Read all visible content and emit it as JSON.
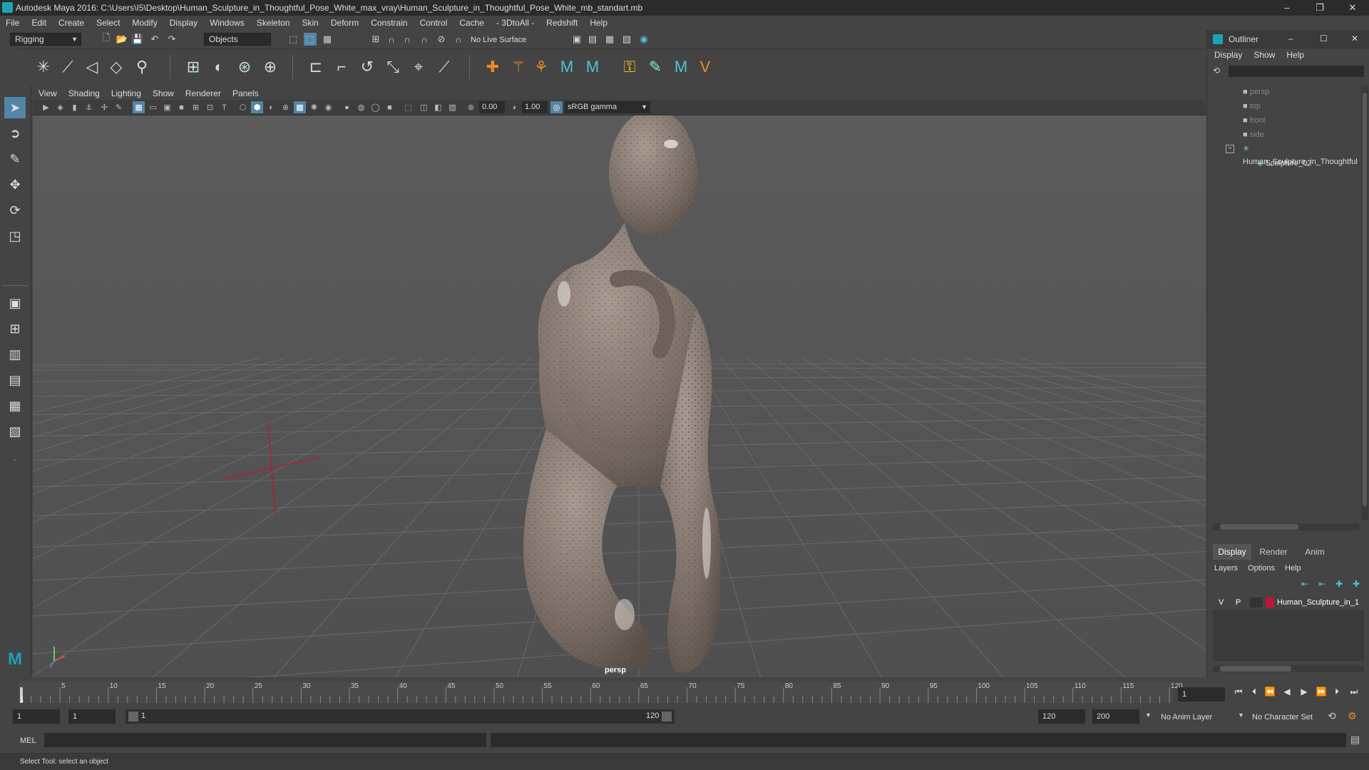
{
  "window": {
    "title": "Autodesk Maya 2016: C:\\Users\\I5\\Desktop\\Human_Sculpture_in_Thoughtful_Pose_White_max_vray\\Human_Sculpture_in_Thoughtful_Pose_White_mb_standart.mb",
    "minimize": "–",
    "restore": "❐",
    "close": "✕"
  },
  "menubar": [
    "File",
    "Edit",
    "Create",
    "Select",
    "Modify",
    "Display",
    "Windows",
    "Skeleton",
    "Skin",
    "Deform",
    "Constrain",
    "Control",
    "Cache",
    "- 3DtoAll -",
    "Redshift",
    "Help"
  ],
  "statusline": {
    "menuset": "Rigging",
    "selection_mode": "Objects",
    "live_surface": "No Live Surface"
  },
  "panel": {
    "menus": [
      "View",
      "Shading",
      "Lighting",
      "Show",
      "Renderer",
      "Panels"
    ],
    "exposure": "0.00",
    "gamma": "1.00",
    "colorspace": "sRGB gamma",
    "camera_label": "persp"
  },
  "outliner": {
    "title": "Outliner",
    "minimize": "–",
    "maximize": "☐",
    "close": "✕",
    "menus": [
      "Display",
      "Show",
      "Help"
    ],
    "items": [
      {
        "label": "persp",
        "type": "camera"
      },
      {
        "label": "top",
        "type": "camera"
      },
      {
        "label": "front",
        "type": "camera"
      },
      {
        "label": "side",
        "type": "camera"
      },
      {
        "label": "Human_Sculpture_in_Thoughtful",
        "type": "group"
      },
      {
        "label": "Sculpture_02",
        "type": "mesh"
      }
    ]
  },
  "layer_editor": {
    "tabs": [
      "Display",
      "Render",
      "Anim"
    ],
    "active_tab": "Display",
    "menus": [
      "Layers",
      "Options",
      "Help"
    ],
    "layer": {
      "v": "V",
      "p": "P",
      "name": "Human_Sculpture_in_1",
      "color": "#c0143c"
    }
  },
  "timeline": {
    "ticks": [
      "5",
      "10",
      "15",
      "20",
      "25",
      "30",
      "35",
      "40",
      "45",
      "50",
      "55",
      "60",
      "65",
      "70",
      "75",
      "80",
      "85",
      "90",
      "95",
      "100",
      "105",
      "110",
      "115",
      "120"
    ],
    "current_frame": "1",
    "start_marker": "1"
  },
  "range": {
    "start": "1",
    "playback_start": "1",
    "slider_start": "1",
    "slider_end": "120",
    "playback_end": "120",
    "end": "200",
    "anim_layer": "No Anim Layer",
    "character_set": "No Character Set"
  },
  "cmdline": {
    "label": "MEL"
  },
  "helpline": {
    "text": "Select Tool: select an object"
  },
  "colors": {
    "accent": "#5285a6",
    "layer_color": "#c0143c",
    "manip_red": "#c8102e"
  }
}
